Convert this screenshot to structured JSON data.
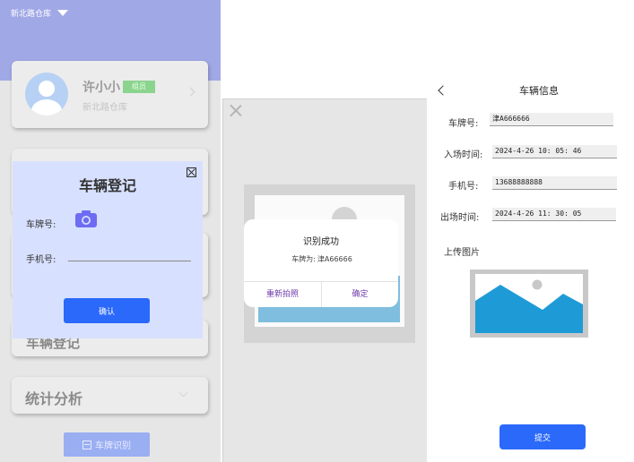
{
  "panel1": {
    "warehouse_selector": "新北路仓库",
    "user": {
      "name": "许小小",
      "role": "组员",
      "warehouse": "新北路仓库"
    },
    "menu_partial_label": "车辆登记",
    "menu_stats_label": "统计分析",
    "plate_recognition_button": "车牌识别",
    "register_dialog": {
      "title": "车辆登记",
      "plate_label": "车牌号:",
      "phone_label": "手机号:",
      "phone_value": "",
      "confirm_label": "确认"
    }
  },
  "panel2": {
    "result_dialog": {
      "title": "识别成功",
      "plate_prefix": "车牌为:",
      "plate_value": "津A66666",
      "retake_label": "重新拍照",
      "confirm_label": "确定"
    }
  },
  "panel3": {
    "title": "车辆信息",
    "plate_label": "车牌号:",
    "plate_value": "津A666666",
    "entry_label": "入场时间:",
    "entry_value": "2024-4-26 10: 05: 46",
    "phone_label": "手机号:",
    "phone_value": "13688888888",
    "exit_label": "出场时间:",
    "exit_value": "2024-4-26 11: 30: 05",
    "upload_label": "上传图片",
    "submit_label": "提交"
  },
  "colors": {
    "header_purple": "#a0a8e6",
    "dialog_lavender": "#d7e0fe",
    "primary_blue": "#2a69fa",
    "role_badge_green": "#8bd48e",
    "link_purple": "#6d3aa8",
    "image_blue": "#1e9bd7"
  },
  "icons": [
    "dropdown-triangle-icon",
    "avatar-icon",
    "chevron-right-icon",
    "chevron-down-icon",
    "scan-icon",
    "close-box-icon",
    "camera-icon",
    "close-icon",
    "image-placeholder-icon",
    "back-arrow-icon"
  ]
}
